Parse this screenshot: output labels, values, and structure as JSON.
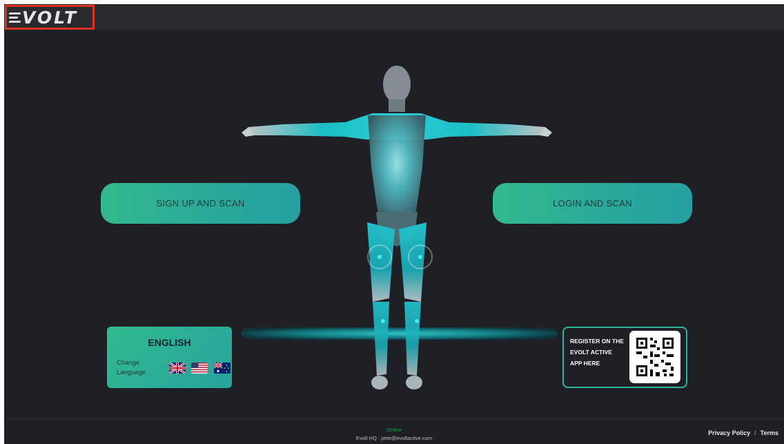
{
  "brand": {
    "logo_text": "VOLT",
    "logo_prefix": "E"
  },
  "hero": {
    "signup_label": "SIGN UP AND SCAN",
    "login_label": "LOGIN AND SCAN"
  },
  "language": {
    "title": "ENGLISH",
    "change_label_line1": "Change",
    "change_label_line2": "Language",
    "flags": [
      "uk-flag",
      "us-flag",
      "australia-flag"
    ]
  },
  "register": {
    "line1": "REGISTER ON THE",
    "line2": "EVOLT ACTIVE",
    "line3": "APP HERE"
  },
  "footer": {
    "status": "Online",
    "hq": "Evolt HQ : pete@evoltactive.com",
    "privacy": "Privacy Policy",
    "separator": "/",
    "terms": "Terms"
  },
  "colors": {
    "background": "#1f2025",
    "topbar": "#2a2b31",
    "accent_teal": "#2fb59a",
    "logo_highlight": "#e0331f",
    "status_green": "#1fa34a"
  }
}
